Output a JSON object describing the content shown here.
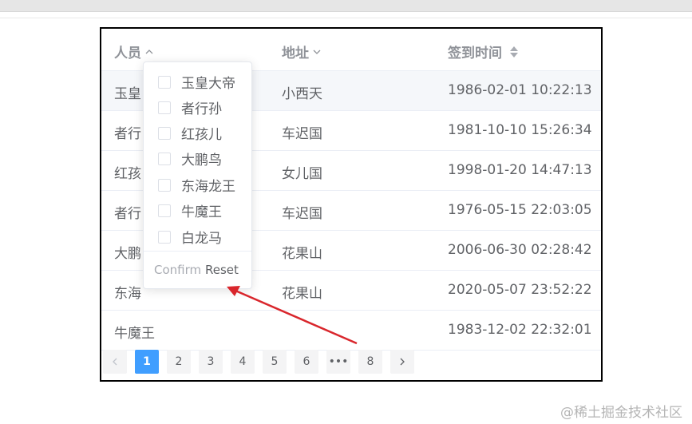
{
  "table": {
    "headers": {
      "person": "人员",
      "address": "地址",
      "checkin": "签到时间"
    },
    "rows": [
      {
        "person": "玉皇",
        "address": "小西天",
        "time": "1986-02-01 10:22:13"
      },
      {
        "person": "者行",
        "address": "车迟国",
        "time": "1981-10-10 15:26:34"
      },
      {
        "person": "红孩",
        "address": "女儿国",
        "time": "1998-01-20 14:47:13"
      },
      {
        "person": "者行",
        "address": "车迟国",
        "time": "1976-05-15 22:03:05"
      },
      {
        "person": "大鹏",
        "address": "花果山",
        "time": "2006-06-30 02:28:42"
      },
      {
        "person": "东海",
        "address": "花果山",
        "time": "2020-05-07 23:52:22"
      },
      {
        "person": "牛魔王",
        "address": "",
        "time": "1983-12-02 22:32:01"
      }
    ]
  },
  "filter": {
    "options": [
      "玉皇大帝",
      "者行孙",
      "红孩儿",
      "大鹏鸟",
      "东海龙王",
      "牛魔王",
      "白龙马"
    ],
    "confirm_label": "Confirm",
    "reset_label": "Reset"
  },
  "pagination": {
    "pages": [
      "1",
      "2",
      "3",
      "4",
      "5",
      "6",
      "•••",
      "8"
    ],
    "current": "1",
    "prev_icon": "chevron-left-icon",
    "next_icon": "chevron-right-icon"
  },
  "annotation": {
    "color": "#d9262c"
  },
  "colors": {
    "accent": "#409eff",
    "header_text": "#909399",
    "body_text": "#606266"
  },
  "watermark": "@稀土掘金技术社区"
}
